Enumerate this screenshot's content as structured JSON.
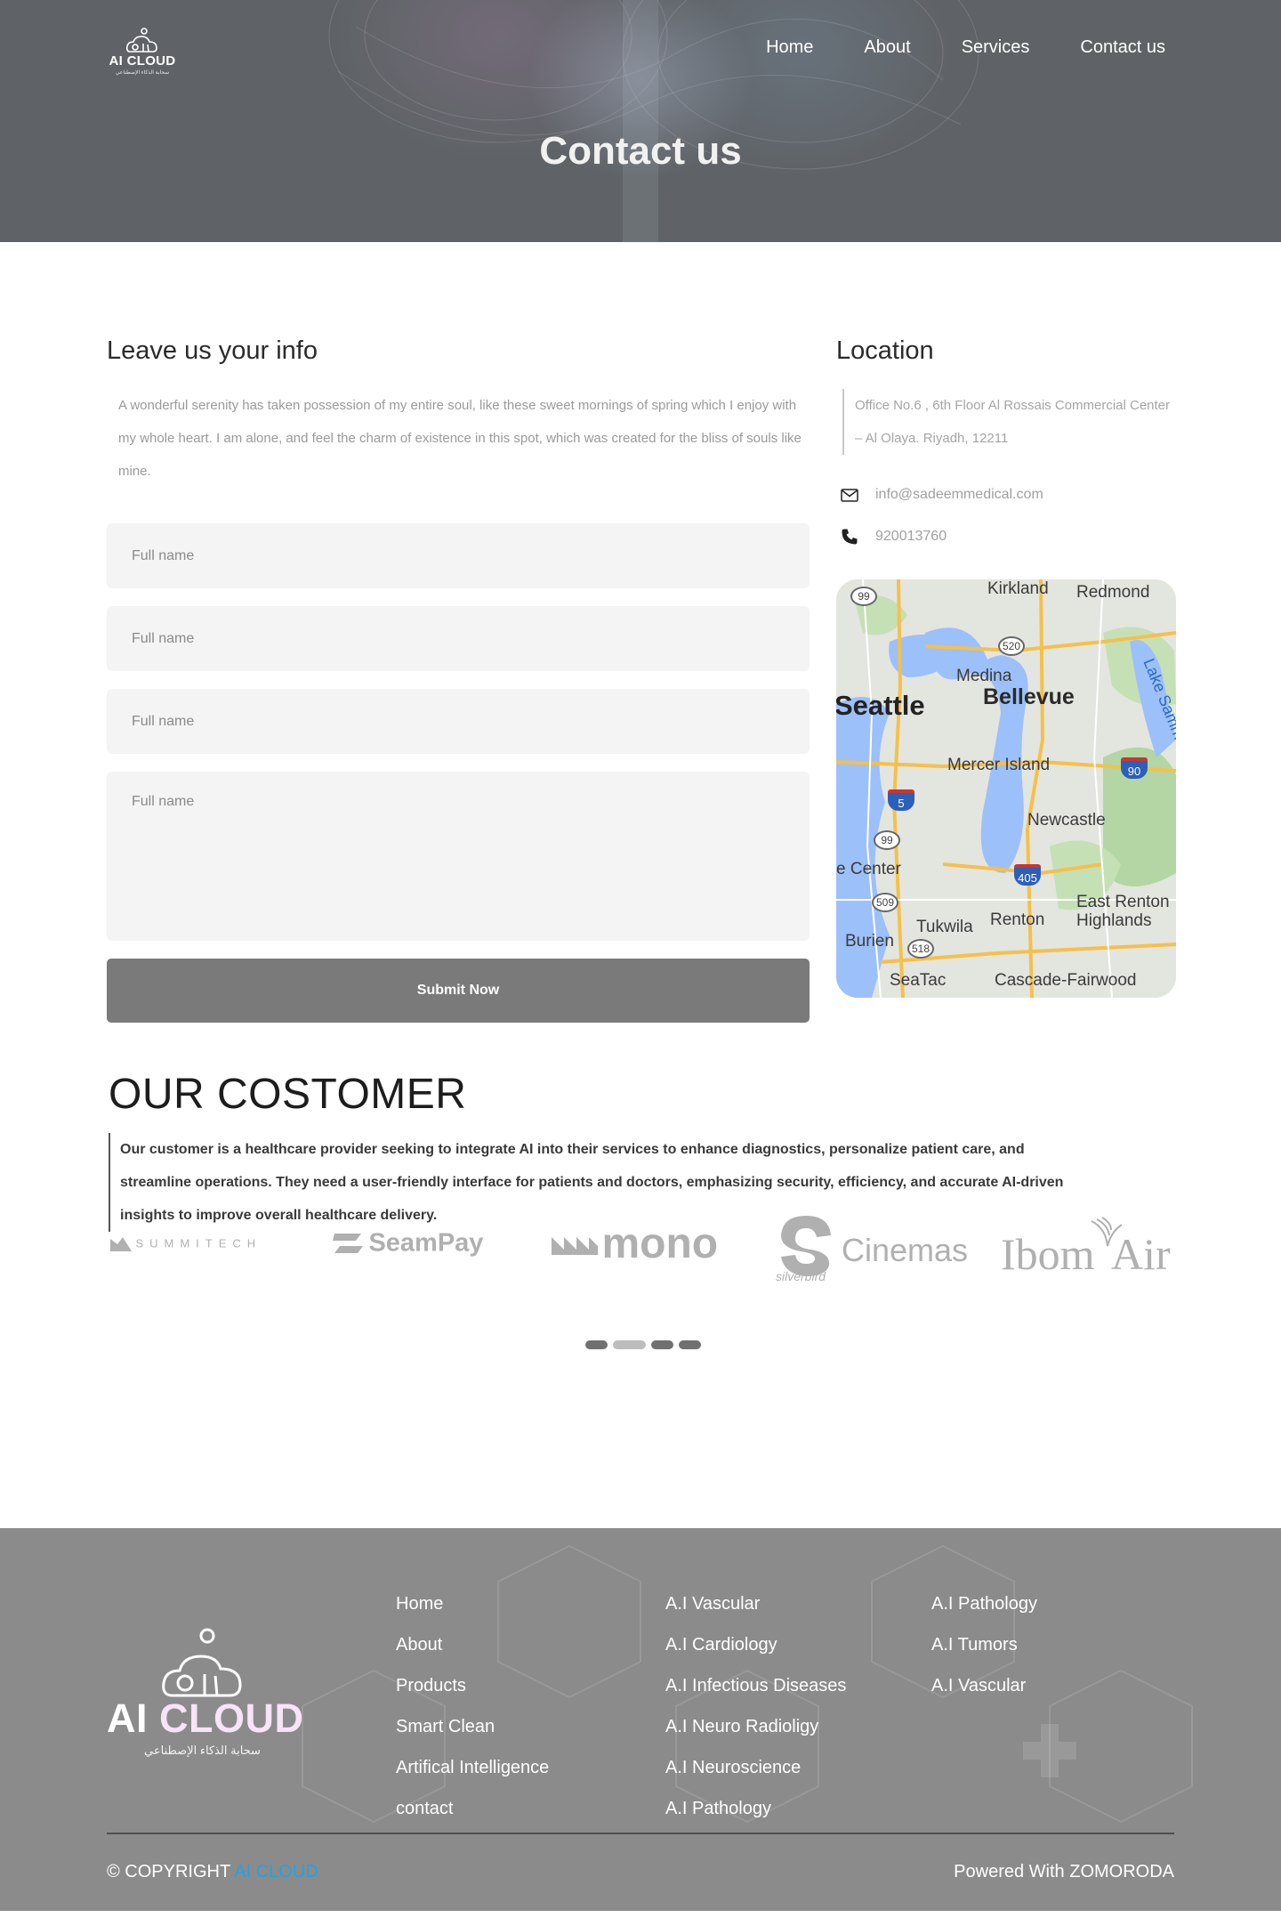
{
  "nav": {
    "logo_name": "AI CLOUD",
    "logo_sub": "سحابة الذكاء الإصطناعي",
    "items": [
      "Home",
      "About",
      "Services",
      "Contact us"
    ]
  },
  "hero": {
    "title": "Contact us"
  },
  "form": {
    "heading": "Leave us your info",
    "intro": "A wonderful serenity has taken possession of my entire soul, like these sweet mornings of spring which I enjoy with my whole heart. I am alone, and feel the charm of existence in this spot, which was created for the bliss of souls like mine.",
    "placeholders": [
      "Full name",
      "Full name",
      "Full name",
      "Full name"
    ],
    "submit_label": "Submit Now"
  },
  "location": {
    "heading": "Location",
    "address": "Office No.6 , 6th Floor Al Rossais Commercial Center – Al Olaya. Riyadh, 12211",
    "email": "info@sadeemmedical.com",
    "phone": "920013760",
    "map": {
      "places": [
        "Kirkland",
        "Redmond",
        "Medina",
        "Bellevue",
        "Seattle",
        "Lake Sammamish",
        "Mercer Island",
        "Newcastle",
        "Tukwila",
        "Renton",
        "East Renton Highlands",
        "Burien",
        "SeaTac",
        "Cascade-Fairwood"
      ],
      "center_label": "e Center",
      "routes": [
        "99",
        "520",
        "90",
        "5",
        "99",
        "405",
        "509",
        "518"
      ]
    }
  },
  "customers": {
    "title": "OUR COSTOMER",
    "text": "Our customer is a healthcare provider seeking to integrate AI into their services to enhance diagnostics, personalize patient care, and streamline operations. They need a user-friendly interface for patients and doctors, emphasizing security, efficiency, and accurate AI-driven insights to improve overall healthcare delivery.",
    "logos": [
      "SUMMITECH",
      "SeamPay",
      "mono",
      "Cinemas",
      "silverbird",
      "Ibom",
      "Air"
    ],
    "slider_pages": 4,
    "slider_active_index": 1
  },
  "footer": {
    "logo_name_a": "AI ",
    "logo_name_b": "CLOUD",
    "logo_sub": "سحابة الذكاء الإصطناعي",
    "col1": [
      "Home",
      "About",
      "Products",
      "Smart Clean",
      "Artifical Intelligence",
      "contact"
    ],
    "col2": [
      "A.I Vascular",
      "A.I Cardiology",
      "A.I Infectious Diseases",
      "A.I Neuro Radioligy",
      "A.I Neuroscience",
      "A.I Pathology"
    ],
    "col3": [
      "A.I Pathology",
      "A.I Tumors",
      "A.I Vascular"
    ],
    "copyright_prefix": "© COPYRIGHT ",
    "copyright_brand": "AI CLOUD",
    "powered": "Powered With ZOMORODA"
  },
  "colors": {
    "accent": "#1fa4e6",
    "button": "#7a7a7a",
    "footer_bg": "#8b8b8b",
    "hero_bg": "#5f6367"
  }
}
